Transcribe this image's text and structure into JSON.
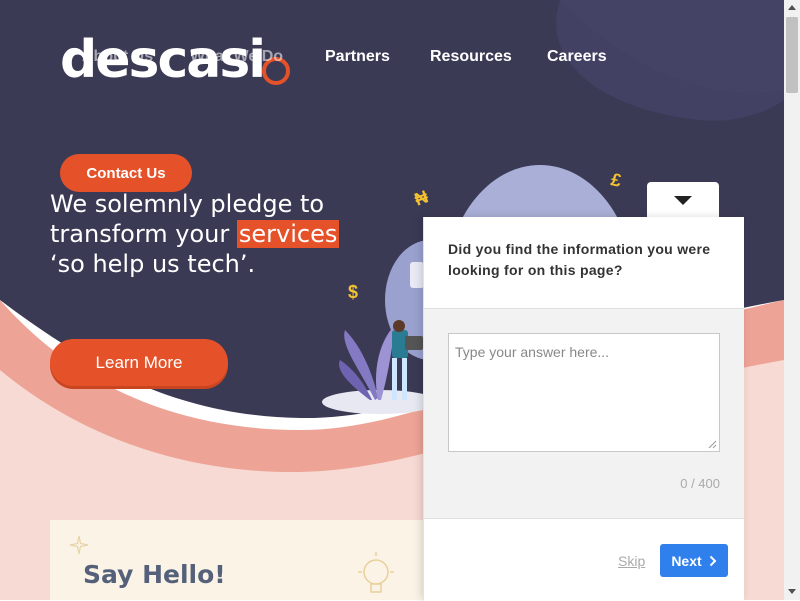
{
  "brand": {
    "logo_text": "descasi",
    "accent": "#e5522a",
    "navy": "#3b3a55"
  },
  "nav": {
    "items": [
      {
        "label": "About Us",
        "faded": true
      },
      {
        "label": "What We Do",
        "faded": true
      },
      {
        "label": "Partners",
        "faded": false
      },
      {
        "label": "Resources",
        "faded": false
      },
      {
        "label": "Careers",
        "faded": false
      }
    ]
  },
  "hero": {
    "contact_label": "Contact Us",
    "headline_pre": "We solemnly pledge to transform your ",
    "headline_highlight": "services",
    "headline_post": " ‘so help us tech’.",
    "learn_more_label": "Learn More",
    "currency_symbols": [
      "$",
      "£",
      "₦"
    ]
  },
  "say_hello": {
    "title": "Say Hello!"
  },
  "survey": {
    "question": "Did you find the information you were looking for on this page?",
    "answer_placeholder": "Type your answer here...",
    "answer_value": "",
    "char_count": "0 / 400",
    "skip_label": "Skip",
    "next_label": "Next",
    "next_icon": "chevron-right-icon",
    "tab_icon": "caret-down-icon",
    "next_color": "#2f80ed"
  }
}
